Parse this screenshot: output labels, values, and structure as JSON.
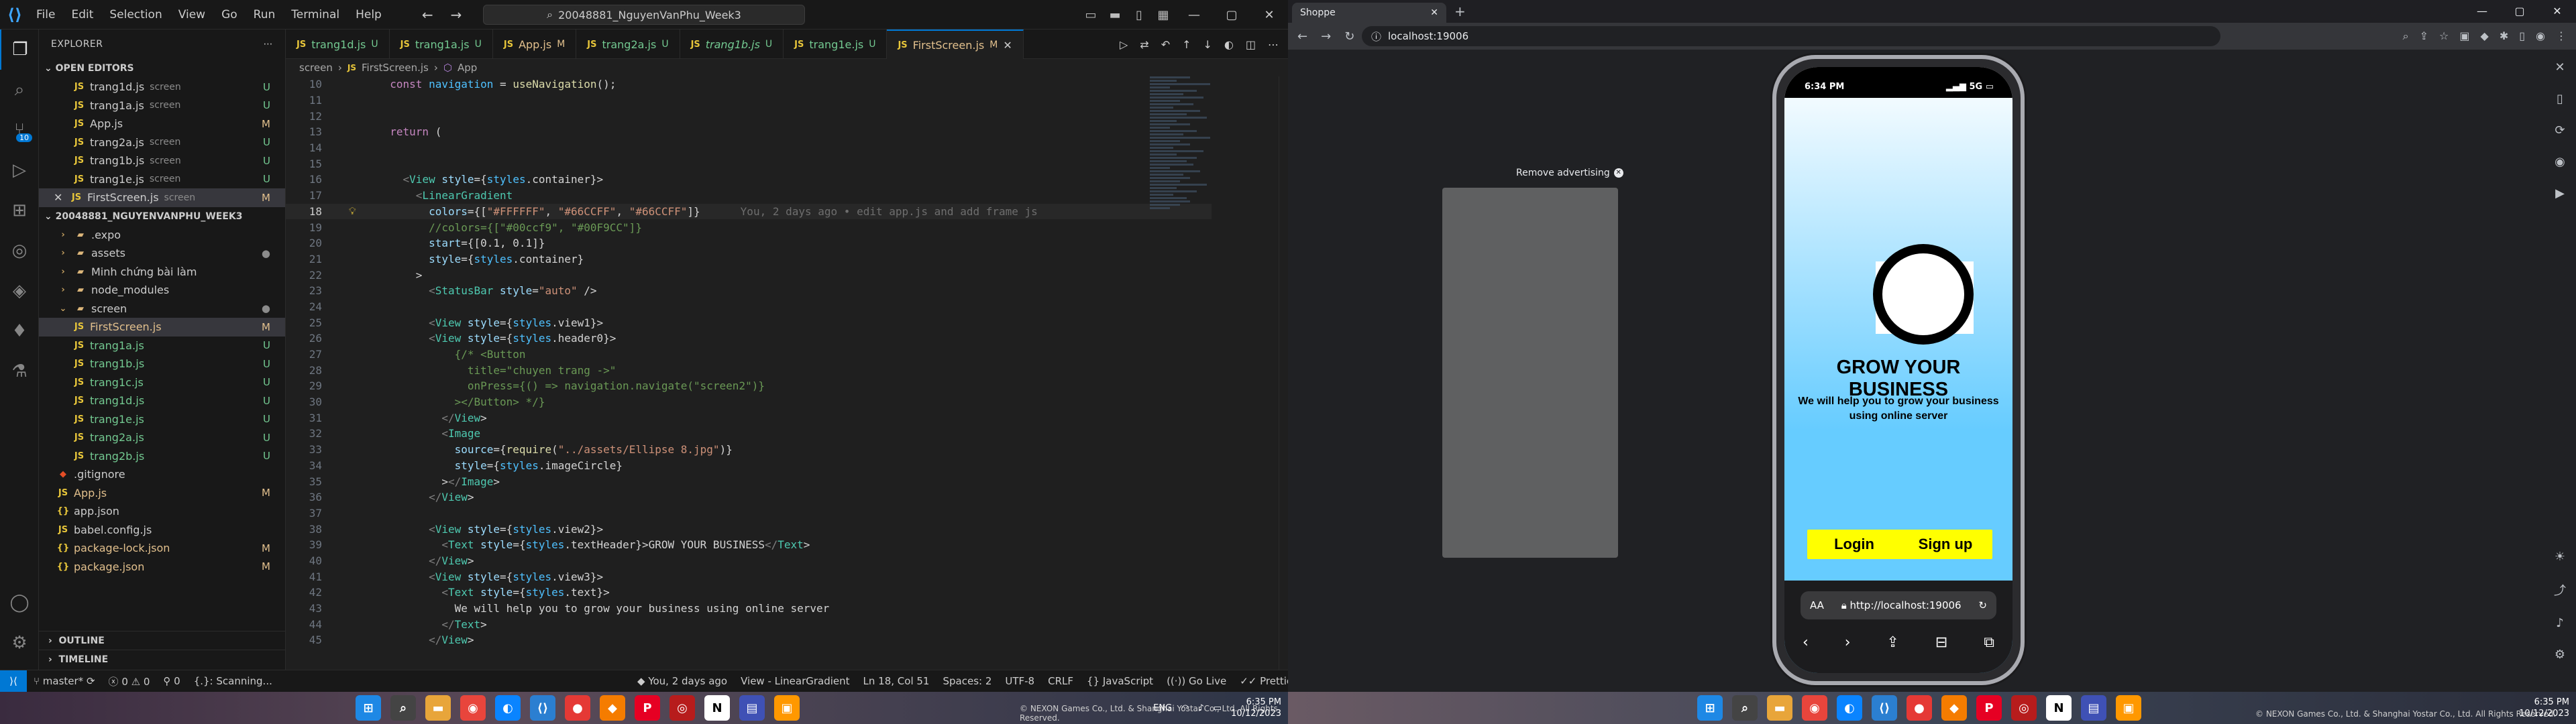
{
  "vscode": {
    "title": "20048881_NguyenVanPhu_Week3",
    "menu": [
      "File",
      "Edit",
      "Selection",
      "View",
      "Go",
      "Run",
      "Terminal",
      "Help"
    ],
    "explorer_title": "EXPLORER",
    "open_editors_label": "OPEN EDITORS",
    "open_editors": [
      {
        "name": "trang1d.js",
        "dir": "screen",
        "status": "U"
      },
      {
        "name": "trang1a.js",
        "dir": "screen",
        "status": "U"
      },
      {
        "name": "App.js",
        "dir": "",
        "status": "M"
      },
      {
        "name": "trang2a.js",
        "dir": "screen",
        "status": "U"
      },
      {
        "name": "trang1b.js",
        "dir": "screen",
        "status": "U"
      },
      {
        "name": "trang1e.js",
        "dir": "screen",
        "status": "U"
      },
      {
        "name": "FirstScreen.js",
        "dir": "screen",
        "status": "M"
      }
    ],
    "project_label": "20048881_NGUYENVANPHU_WEEK3",
    "tree": [
      {
        "name": ".expo",
        "kind": "folder",
        "depth": 1,
        "status": ""
      },
      {
        "name": "assets",
        "kind": "folder",
        "depth": 1,
        "status": "dot"
      },
      {
        "name": "Minh chứng bài làm",
        "kind": "folder",
        "depth": 1,
        "status": ""
      },
      {
        "name": "node_modules",
        "kind": "folder",
        "depth": 1,
        "status": ""
      },
      {
        "name": "screen",
        "kind": "folder-open",
        "depth": 1,
        "status": "dot"
      },
      {
        "name": "FirstScreen.js",
        "kind": "js",
        "depth": 2,
        "status": "M"
      },
      {
        "name": "trang1a.js",
        "kind": "js",
        "depth": 2,
        "status": "U"
      },
      {
        "name": "trang1b.js",
        "kind": "js",
        "depth": 2,
        "status": "U"
      },
      {
        "name": "trang1c.js",
        "kind": "js",
        "depth": 2,
        "status": "U"
      },
      {
        "name": "trang1d.js",
        "kind": "js",
        "depth": 2,
        "status": "U"
      },
      {
        "name": "trang1e.js",
        "kind": "js",
        "depth": 2,
        "status": "U"
      },
      {
        "name": "trang2a.js",
        "kind": "js",
        "depth": 2,
        "status": "U"
      },
      {
        "name": "trang2b.js",
        "kind": "js",
        "depth": 2,
        "status": "U"
      },
      {
        "name": ".gitignore",
        "kind": "git",
        "depth": 1,
        "status": ""
      },
      {
        "name": "App.js",
        "kind": "js",
        "depth": 1,
        "status": "M"
      },
      {
        "name": "app.json",
        "kind": "json",
        "depth": 1,
        "status": ""
      },
      {
        "name": "babel.config.js",
        "kind": "js",
        "depth": 1,
        "status": ""
      },
      {
        "name": "package-lock.json",
        "kind": "json",
        "depth": 1,
        "status": "M"
      },
      {
        "name": "package.json",
        "kind": "json",
        "depth": 1,
        "status": "M"
      }
    ],
    "outline_label": "OUTLINE",
    "timeline_label": "TIMELINE",
    "tabs": [
      {
        "name": "trang1d.js",
        "status": "U",
        "italic": false
      },
      {
        "name": "trang1a.js",
        "status": "U",
        "italic": false
      },
      {
        "name": "App.js",
        "status": "M",
        "italic": false
      },
      {
        "name": "trang2a.js",
        "status": "U",
        "italic": false
      },
      {
        "name": "trang1b.js",
        "status": "U",
        "italic": true
      },
      {
        "name": "trang1e.js",
        "status": "U",
        "italic": false
      },
      {
        "name": "FirstScreen.js",
        "status": "M",
        "italic": false
      }
    ],
    "breadcrumb": [
      "screen",
      "FirstScreen.js",
      "App"
    ],
    "code_lines": [
      {
        "n": "10",
        "t": "  const navigation = useNavigation();"
      },
      {
        "n": "11",
        "t": ""
      },
      {
        "n": "12",
        "t": ""
      },
      {
        "n": "13",
        "t": "  return ("
      },
      {
        "n": "14",
        "t": ""
      },
      {
        "n": "15",
        "t": ""
      },
      {
        "n": "16",
        "t": "    <View style={styles.container}>"
      },
      {
        "n": "17",
        "t": "      <LinearGradient"
      },
      {
        "n": "18",
        "t": "        colors={[\"#FFFFFF\", \"#66CCFF\", \"#66CCFF\"]}"
      },
      {
        "n": "19",
        "t": "        //colors={[\"#00ccf9\", \"#00F9CC\"]}"
      },
      {
        "n": "20",
        "t": "        start={[0.1, 0.1]}"
      },
      {
        "n": "21",
        "t": "        style={styles.container}"
      },
      {
        "n": "22",
        "t": "      >"
      },
      {
        "n": "23",
        "t": "        <StatusBar style=\"auto\" />"
      },
      {
        "n": "24",
        "t": ""
      },
      {
        "n": "25",
        "t": "        <View style={styles.view1}>"
      },
      {
        "n": "26",
        "t": "        <View style={styles.header0}>"
      },
      {
        "n": "27",
        "t": "            {/* <Button"
      },
      {
        "n": "28",
        "t": "              title=\"chuyen trang ->\""
      },
      {
        "n": "29",
        "t": "              onPress={() => navigation.navigate(\"screen2\")}"
      },
      {
        "n": "30",
        "t": "            ></Button> */}"
      },
      {
        "n": "31",
        "t": "          </View>"
      },
      {
        "n": "32",
        "t": "          <Image"
      },
      {
        "n": "33",
        "t": "            source={require(\"../assets/Ellipse 8.jpg\")}"
      },
      {
        "n": "34",
        "t": "            style={styles.imageCircle}"
      },
      {
        "n": "35",
        "t": "          ></Image>"
      },
      {
        "n": "36",
        "t": "        </View>"
      },
      {
        "n": "37",
        "t": ""
      },
      {
        "n": "38",
        "t": "        <View style={styles.view2}>"
      },
      {
        "n": "39",
        "t": "          <Text style={styles.textHeader}>GROW YOUR BUSINESS</Text>"
      },
      {
        "n": "40",
        "t": "        </View>"
      },
      {
        "n": "41",
        "t": "        <View style={styles.view3}>"
      },
      {
        "n": "42",
        "t": "          <Text style={styles.text}>"
      },
      {
        "n": "43",
        "t": "            We will help you to grow your business using online server"
      },
      {
        "n": "44",
        "t": "          </Text>"
      },
      {
        "n": "45",
        "t": "        </View>"
      }
    ],
    "blame": "You, 2 days ago • edit app.js and add frame js",
    "status": {
      "branch": "master*",
      "errors": "0",
      "warnings": "0",
      "ports": "0",
      "scanning": "{.}: Scanning...",
      "blame": "You, 2 days ago",
      "view": "View - LinearGradient",
      "position": "Ln 18, Col 51",
      "spaces": "Spaces: 2",
      "encoding": "UTF-8",
      "eol": "CRLF",
      "language": "JavaScript",
      "golive": "Go Live",
      "prettier": "Prettier"
    }
  },
  "browser": {
    "tab_title": "Shoppe",
    "url": "localhost:19006",
    "ad_label": "Remove advertising",
    "phone": {
      "time": "6:34 PM",
      "signal": "5G",
      "title": "GROW YOUR BUSINESS",
      "subtitle": "We will help you to grow your business using online server",
      "login": "Login",
      "signup": "Sign up",
      "safari_aa": "AA",
      "safari_url": "http://localhost:19006",
      "gradient": [
        "#FFFFFF",
        "#66CCFF",
        "#66CCFF"
      ],
      "button_color": "#FFFF00"
    }
  },
  "taskbar": {
    "left_copyright": "© NEXON Games Co., Ltd. & Shanghai Yostar Co., Ltd. All Rights Reserved.",
    "left_time": "6:35 PM",
    "left_date": "10/12/2023",
    "left_lang": "ENG",
    "right_copyright": "© NEXON Games Co., Ltd. & Shanghai Yostar Co., Ltd. All Rights Reserved.",
    "right_time": "6:35 PM",
    "right_date": "10/12/2023"
  },
  "colors": {
    "accent": "#0078d4",
    "untracked": "#73c991",
    "modified": "#e2c08d"
  }
}
